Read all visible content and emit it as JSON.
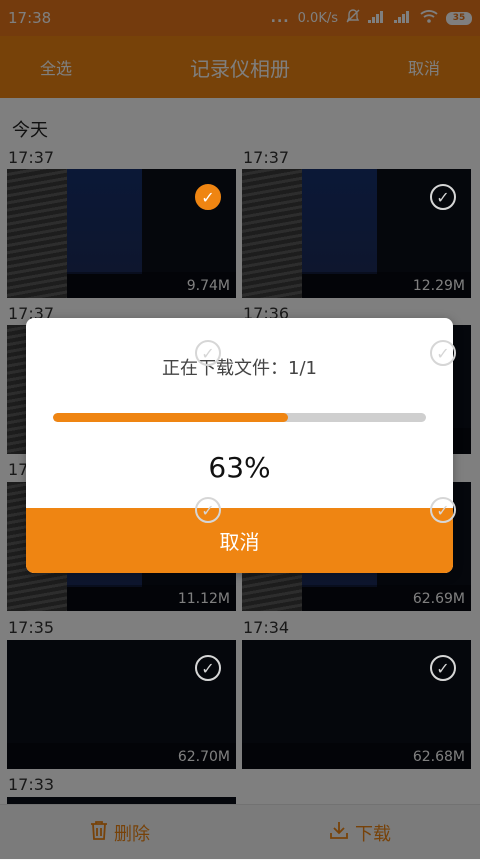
{
  "status_bar": {
    "time": "17:38",
    "dots": "...",
    "speed": "0.0K/s",
    "battery": "35"
  },
  "header": {
    "select_all": "全选",
    "title": "记录仪相册",
    "cancel": "取消"
  },
  "gallery": {
    "section_today": "今天",
    "items": [
      {
        "time": "17:37",
        "size": "9.74M",
        "selected": true
      },
      {
        "time": "17:37",
        "size": "12.29M",
        "selected": false
      },
      {
        "time": "17:37",
        "size": "",
        "selected": false
      },
      {
        "time": "17:36",
        "size": "",
        "selected": false
      },
      {
        "time": "17",
        "size": "11.12M",
        "selected": false
      },
      {
        "time": "",
        "size": "62.69M",
        "selected": false
      },
      {
        "time": "17:35",
        "size": "62.70M",
        "selected": false
      },
      {
        "time": "17:34",
        "size": "62.68M",
        "selected": false
      },
      {
        "time": "17:33",
        "size": "",
        "selected": false
      }
    ]
  },
  "bottom_bar": {
    "delete": "删除",
    "download": "下载"
  },
  "dialog": {
    "message": "正在下载文件：1/1",
    "progress": 0.63,
    "percent_text": "63%",
    "cancel": "取消"
  },
  "colors": {
    "accent": "#ef8512",
    "status_bar": "#e9771a",
    "overlay": "rgba(0,0,0,0.5)"
  },
  "icons": {
    "check": "checkmark-circle-icon",
    "delete": "trash-icon",
    "download": "download-icon"
  }
}
